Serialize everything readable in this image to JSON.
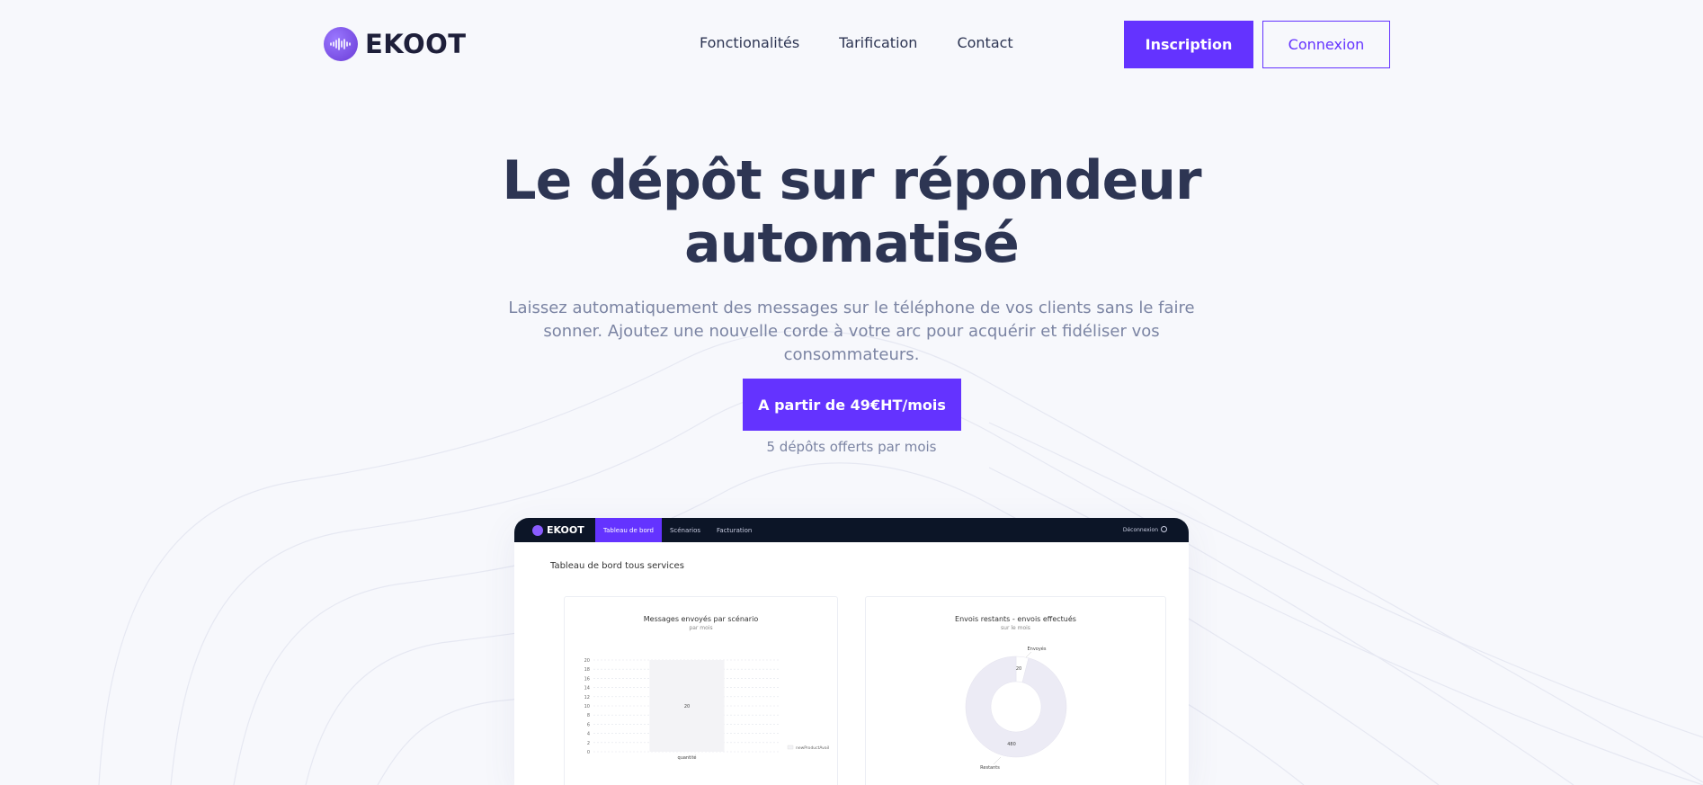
{
  "header": {
    "logo_text": "EKOOT",
    "nav": [
      "Fonctionalités",
      "Tarification",
      "Contact"
    ],
    "signup_label": "Inscription",
    "login_label": "Connexion"
  },
  "hero": {
    "title_line1": "Le dépôt sur répondeur",
    "title_line2": "automatisé",
    "subtitle_line1": "Laissez automatiquement des messages sur le téléphone de vos clients sans le faire",
    "subtitle_line2": "sonner. Ajoutez une nouvelle corde à votre arc pour acquérir et fidéliser vos consommateurs.",
    "cta_label": "A partir de 49€HT/mois",
    "cta_note": "5 dépôts offerts par mois"
  },
  "dashboard": {
    "logo_text": "EKOOT",
    "tabs": [
      "Tableau de bord",
      "Scénarios",
      "Facturation"
    ],
    "logout_label": "Déconnexion",
    "page_title": "Tableau de bord tous services",
    "chart1": {
      "title": "Messages envoyés par scénario",
      "subtitle": "par mois"
    },
    "chart2": {
      "title": "Envois restants - envois effectués",
      "subtitle": "sur le mois"
    }
  },
  "chart_data": [
    {
      "type": "bar",
      "title": "Messages envoyés par scénario",
      "subtitle": "par mois",
      "categories": [
        "quantité"
      ],
      "series": [
        {
          "name": "newProductAvail",
          "values": [
            20
          ]
        }
      ],
      "ylim": [
        0,
        20
      ],
      "yticks": [
        0,
        2,
        4,
        6,
        8,
        10,
        12,
        14,
        16,
        18,
        20
      ],
      "data_labels": [
        "20"
      ],
      "legend": "right"
    },
    {
      "type": "pie",
      "title": "Envois restants - envois effectués",
      "subtitle": "sur le mois",
      "labels": [
        "Envoyés",
        "Restants"
      ],
      "values": [
        20,
        480
      ],
      "data_labels": [
        "20",
        "480"
      ]
    }
  ],
  "colors": {
    "accent": "#6433ff",
    "text_dark": "#2d3553",
    "text_muted": "#7b84a3",
    "dashboard_bar": "#0c1527",
    "donut": "#ecebf5"
  }
}
